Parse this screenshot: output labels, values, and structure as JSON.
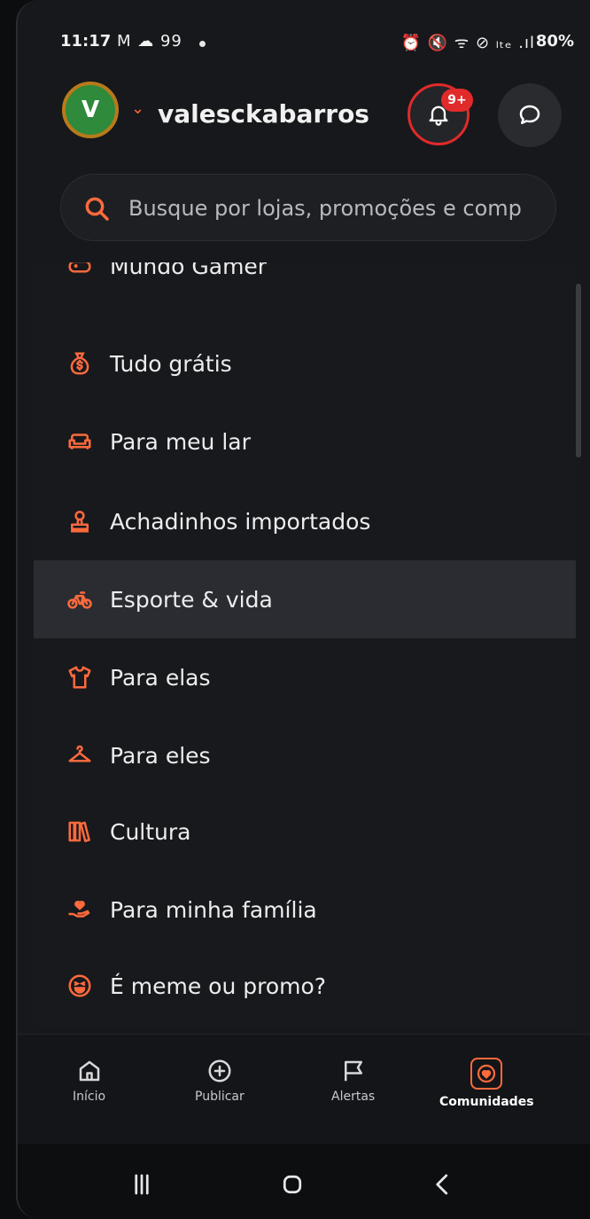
{
  "status": {
    "time": "11:17",
    "time_icons": "M ☁ 99",
    "right_icons": "⏰ 🔇 ᯤ ⊘ ₗₜₑ .ıl",
    "battery": "80%"
  },
  "header": {
    "avatar_letter": "V",
    "username": "valesckabarros",
    "notification_badge": "9+"
  },
  "search": {
    "placeholder": "Busque por lojas, promoções e comp"
  },
  "categories": [
    {
      "label": "Mundo Gamer",
      "icon": "gamepad-icon"
    },
    {
      "label": "Tudo grátis",
      "icon": "money-bag-icon"
    },
    {
      "label": "Para meu lar",
      "icon": "sofa-icon"
    },
    {
      "label": "Achadinhos importados",
      "icon": "stamp-icon"
    },
    {
      "label": "Esporte & vida",
      "icon": "bicycle-icon"
    },
    {
      "label": "Para elas",
      "icon": "shirt-icon"
    },
    {
      "label": "Para eles",
      "icon": "hanger-icon"
    },
    {
      "label": "Cultura",
      "icon": "books-icon"
    },
    {
      "label": "Para minha família",
      "icon": "hand-heart-icon"
    },
    {
      "label": "É meme ou promo?",
      "icon": "laughing-face-icon"
    }
  ],
  "bottom_nav": [
    {
      "label": "Início",
      "icon": "home-icon"
    },
    {
      "label": "Publicar",
      "icon": "plus-circle-icon"
    },
    {
      "label": "Alertas",
      "icon": "flag-icon"
    },
    {
      "label": "Comunidades",
      "icon": "heart-icon"
    }
  ],
  "colors": {
    "accent": "#ff6a3d",
    "alert_red": "#e12a2a",
    "background": "#18191c"
  }
}
